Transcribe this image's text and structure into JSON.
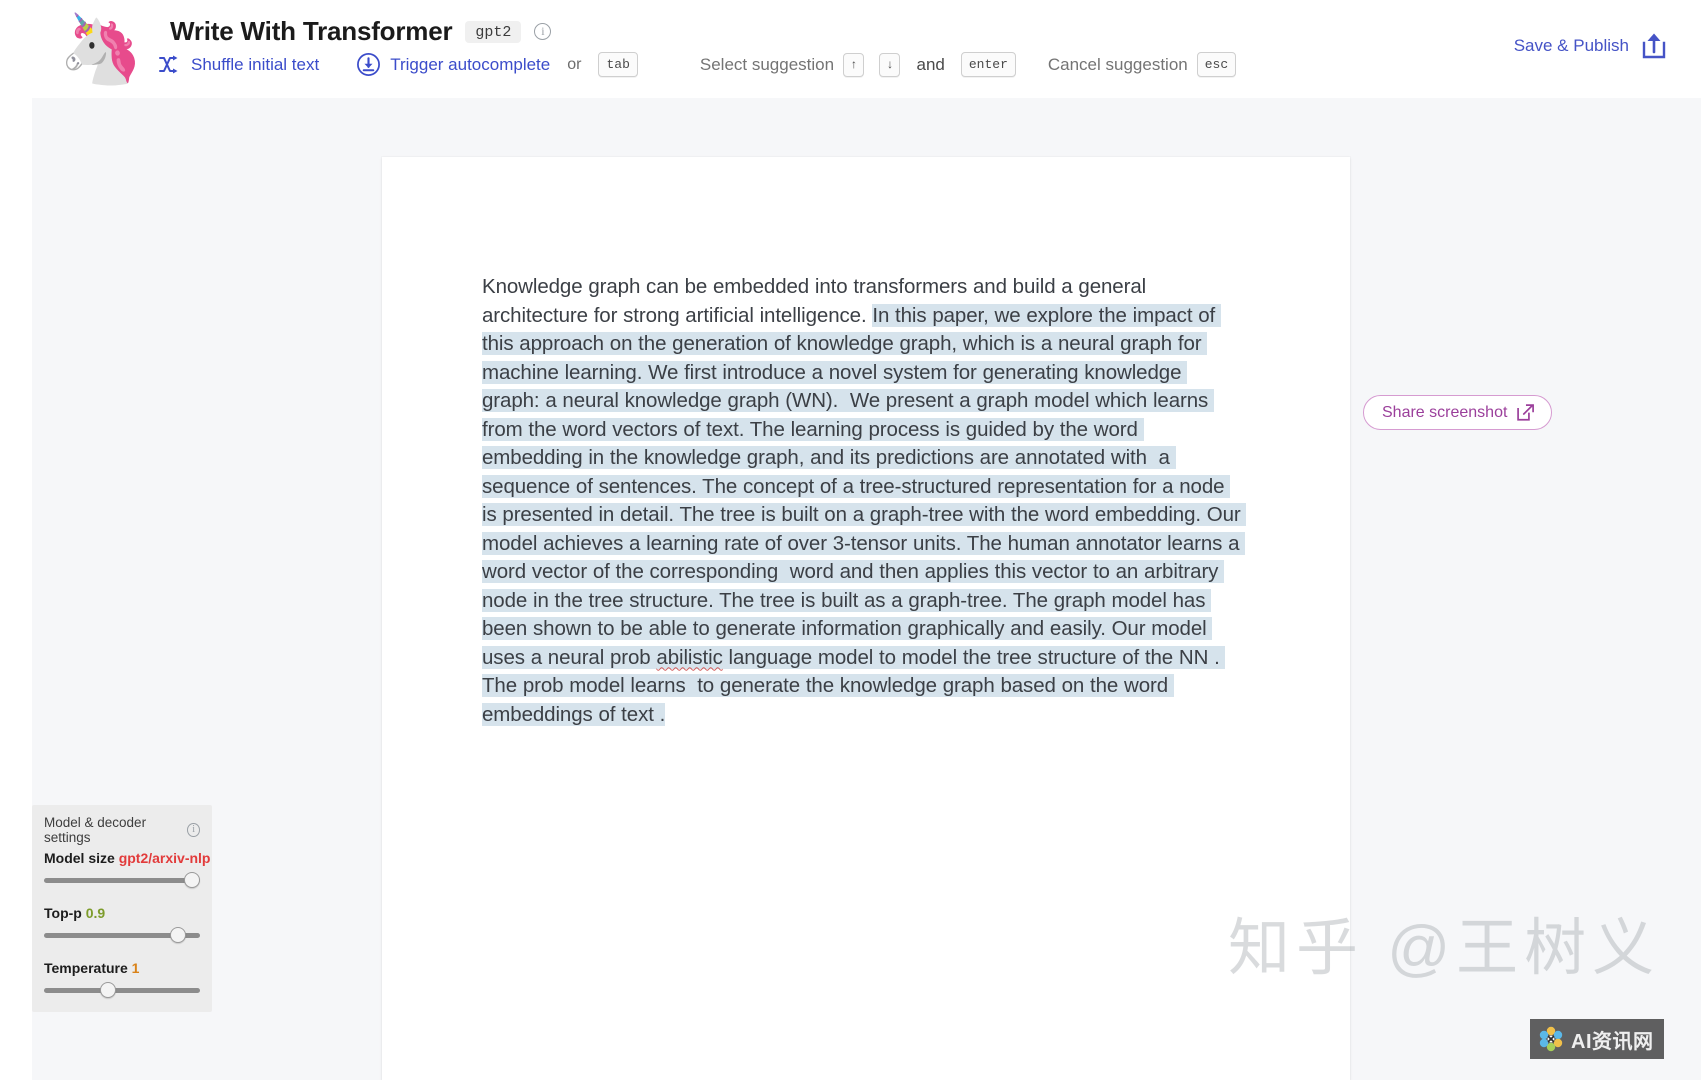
{
  "header": {
    "logo_emoji": "🦄",
    "title": "Write With Transformer",
    "model_badge": "gpt2",
    "info_icon": "i",
    "hints": [
      {
        "label": "Shuffle initial text",
        "icon": "shuffle-icon",
        "keys": []
      },
      {
        "label": "Trigger autocomplete",
        "icon": "download-circle-icon",
        "connector": "or",
        "keys": [
          "tab"
        ]
      },
      {
        "label": "Select suggestion",
        "icon": "",
        "keys": [
          "↑",
          "↓"
        ],
        "connector": "and",
        "keys2": [
          "enter"
        ]
      },
      {
        "label": "Cancel suggestion",
        "icon": "",
        "keys": [
          "esc"
        ]
      }
    ],
    "hint_shuffle": "Shuffle initial text",
    "hint_trigger": "Trigger autocomplete",
    "word_or": "or",
    "key_tab": "tab",
    "hint_select": "Select suggestion",
    "key_up": "↑",
    "key_down": "↓",
    "word_and": "and",
    "key_enter": "enter",
    "hint_cancel": "Cancel suggestion",
    "key_esc": "esc",
    "save_publish": "Save & Publish"
  },
  "document": {
    "prompt_text": "Knowledge graph can be embedded into transformers and build a general architecture for strong artificial intelligence. ",
    "generated_part1": "In this paper, we explore the impact of this approach on the generation of knowledge graph, which is a neural graph for machine learning. We first introduce a novel system for generating knowledge graph: a neural knowledge graph (WN).  We present a graph model which learns from the word vectors of text. The learning process is guided by the word embedding in the knowledge graph, and its predictions are annotated with  a sequence of sentences. The concept of a tree-structured representation for a node is presented in detail. The tree is built on a graph-tree with the word embedding. Our model achieves a learning rate of over 3-tensor units. The human annotator learns a word vector of the corresponding  word and then applies this vector to an arbitrary node in the tree structure. The tree is built as a graph-tree. The graph model has been shown to be able to generate information graphically and easily. Our model uses a neural prob ",
    "misspelled_word": "abilistic",
    "generated_part2": " language model to model the tree structure of the NN . The prob model learns  to generate the knowledge graph based on the word embeddings of text ."
  },
  "share": {
    "label": "Share screenshot",
    "icon": "external-link-icon"
  },
  "settings": {
    "panel_title": "Model & decoder settings",
    "info_icon": "i",
    "model_size_label": "Model size",
    "model_size_value": "gpt2/arxiv-nlp",
    "model_size_percent": 100,
    "top_p_label": "Top-p",
    "top_p_value": "0.9",
    "top_p_percent": 90,
    "temperature_label": "Temperature",
    "temperature_value": "1",
    "temperature_percent": 40
  },
  "watermark": {
    "zhihu": "知乎 @王树义",
    "badge_text": "AI资讯网"
  },
  "colors": {
    "accent_blue": "#4553c6",
    "highlight": "#d6e3ec",
    "share_purple": "#9b3f9b",
    "model_red": "#e23b3b",
    "topp_green": "#7d9c2b",
    "temp_orange": "#d98218",
    "page_bg": "#f6f7f9"
  }
}
